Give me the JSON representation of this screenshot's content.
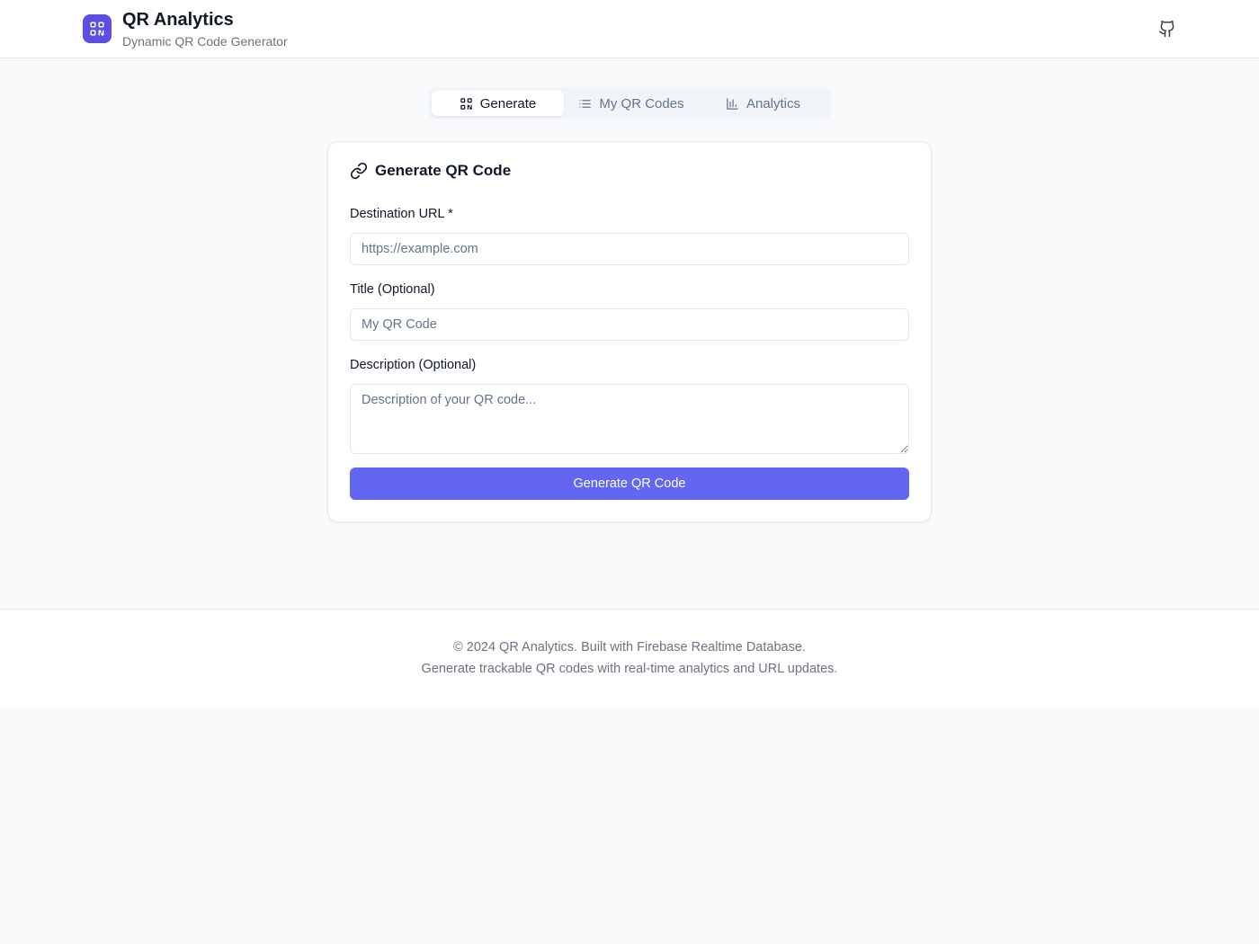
{
  "header": {
    "title": "QR Analytics",
    "subtitle": "Dynamic QR Code Generator",
    "logo_icon": "qr-code-icon",
    "github_icon": "github-icon"
  },
  "tabs": [
    {
      "label": "Generate",
      "icon": "qr-code-icon",
      "active": true
    },
    {
      "label": "My QR Codes",
      "icon": "list-icon",
      "active": false
    },
    {
      "label": "Analytics",
      "icon": "bar-chart-icon",
      "active": false
    }
  ],
  "form": {
    "title": "Generate QR Code",
    "title_icon": "link-icon",
    "url_label": "Destination URL *",
    "url_placeholder": "https://example.com",
    "url_value": "",
    "title_label": "Title (Optional)",
    "title_placeholder": "My QR Code",
    "title_value": "",
    "description_label": "Description (Optional)",
    "description_placeholder": "Description of your QR code...",
    "description_value": "",
    "submit_label": "Generate QR Code"
  },
  "footer": {
    "line1": "© 2024 QR Analytics. Built with Firebase Realtime Database.",
    "line2": "Generate trackable QR codes with real-time analytics and URL updates."
  },
  "colors": {
    "accent": "#6366f1",
    "logo_bg": "#5b4ee0",
    "page_bg": "#f8fafc"
  }
}
